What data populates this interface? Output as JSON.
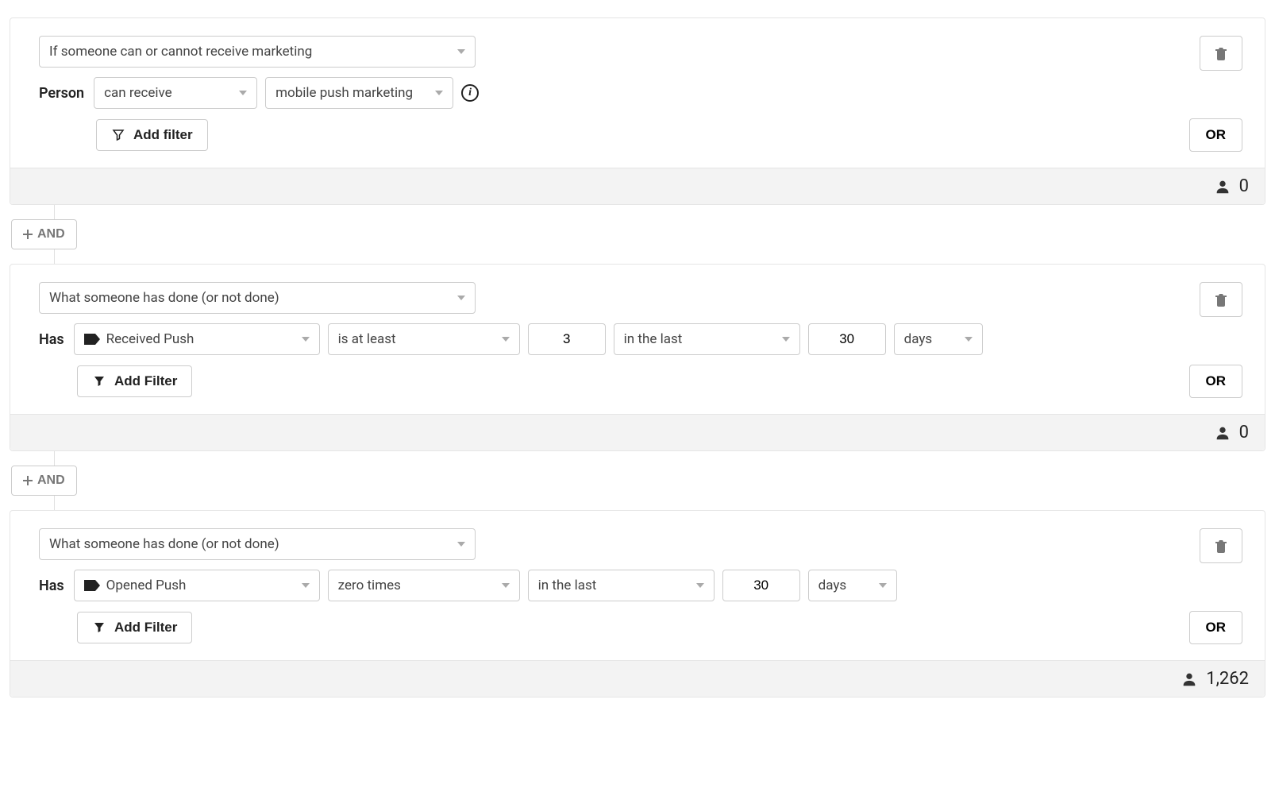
{
  "buttons": {
    "and": "AND",
    "or": "OR",
    "add_filter": "Add filter",
    "add_filter_cap": "Add Filter"
  },
  "labels": {
    "person": "Person",
    "has": "Has"
  },
  "condition1": {
    "type": "If someone can or cannot receive marketing",
    "verb": "can receive",
    "channel": "mobile push marketing",
    "count": "0"
  },
  "condition2": {
    "type": "What someone has done (or not done)",
    "event": "Received Push",
    "comparator": "is at least",
    "value": "3",
    "timeframe": "in the last",
    "timevalue": "30",
    "timeunit": "days",
    "count": "0"
  },
  "condition3": {
    "type": "What someone has done (or not done)",
    "event": "Opened Push",
    "comparator": "zero times",
    "timeframe": "in the last",
    "timevalue": "30",
    "timeunit": "days",
    "count": "1,262"
  }
}
